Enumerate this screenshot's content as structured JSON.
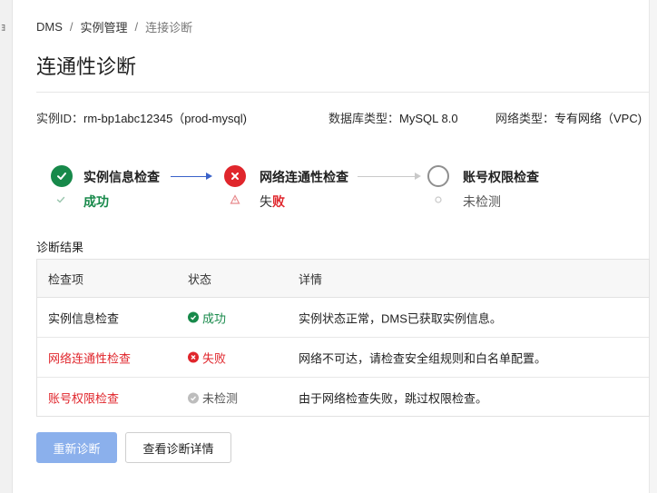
{
  "edge_label": "ﾖ",
  "breadcrumb": [
    {
      "label": "DMS"
    },
    {
      "label": "实例管理"
    },
    {
      "label": "连接诊断"
    }
  ],
  "breadcrumb_separator": "/",
  "page_title": "连通性诊断",
  "instance_info": {
    "instance_label": "实例ID：",
    "instance_value": "rm-bp1abc12345（prod-mysql)",
    "db_type_label": "数据库类型：",
    "db_type_value": "MySQL 8.0",
    "network_label": "网络类型：",
    "network_value": "专有网络（VPC)"
  },
  "steps": [
    {
      "title": "实例信息检查",
      "status_text": "成功",
      "state": "success"
    },
    {
      "title": "网络连通性检查",
      "status_prefix": "失",
      "status_emph": "败",
      "state": "fail"
    },
    {
      "title": "账号权限检查",
      "status_text": "未检测",
      "state": "pending"
    }
  ],
  "results": {
    "title": "诊断结果",
    "columns": [
      "检查项",
      "状态",
      "详情"
    ],
    "rows": [
      {
        "item": "实例信息检查",
        "status": "成功",
        "state": "success",
        "detail": "实例状态正常，DMS已获取实例信息。"
      },
      {
        "item": "网络连通性检查",
        "status": "失败",
        "state": "fail",
        "detail": "网络不可达，请检查安全组规则和白名单配置。"
      },
      {
        "item": "账号权限检查",
        "status": "未检测",
        "state": "pending",
        "detail": "由于网络检查失败，跳过权限检查。"
      }
    ]
  },
  "buttons": {
    "rediagnose": "重新诊断",
    "view_details": "查看诊断详情"
  },
  "colors": {
    "success": "#17894a",
    "fail": "#e0262c",
    "pending": "#8f8f8f",
    "primary_button": "#8bb0ec",
    "connector_active": "#3a62c9"
  }
}
